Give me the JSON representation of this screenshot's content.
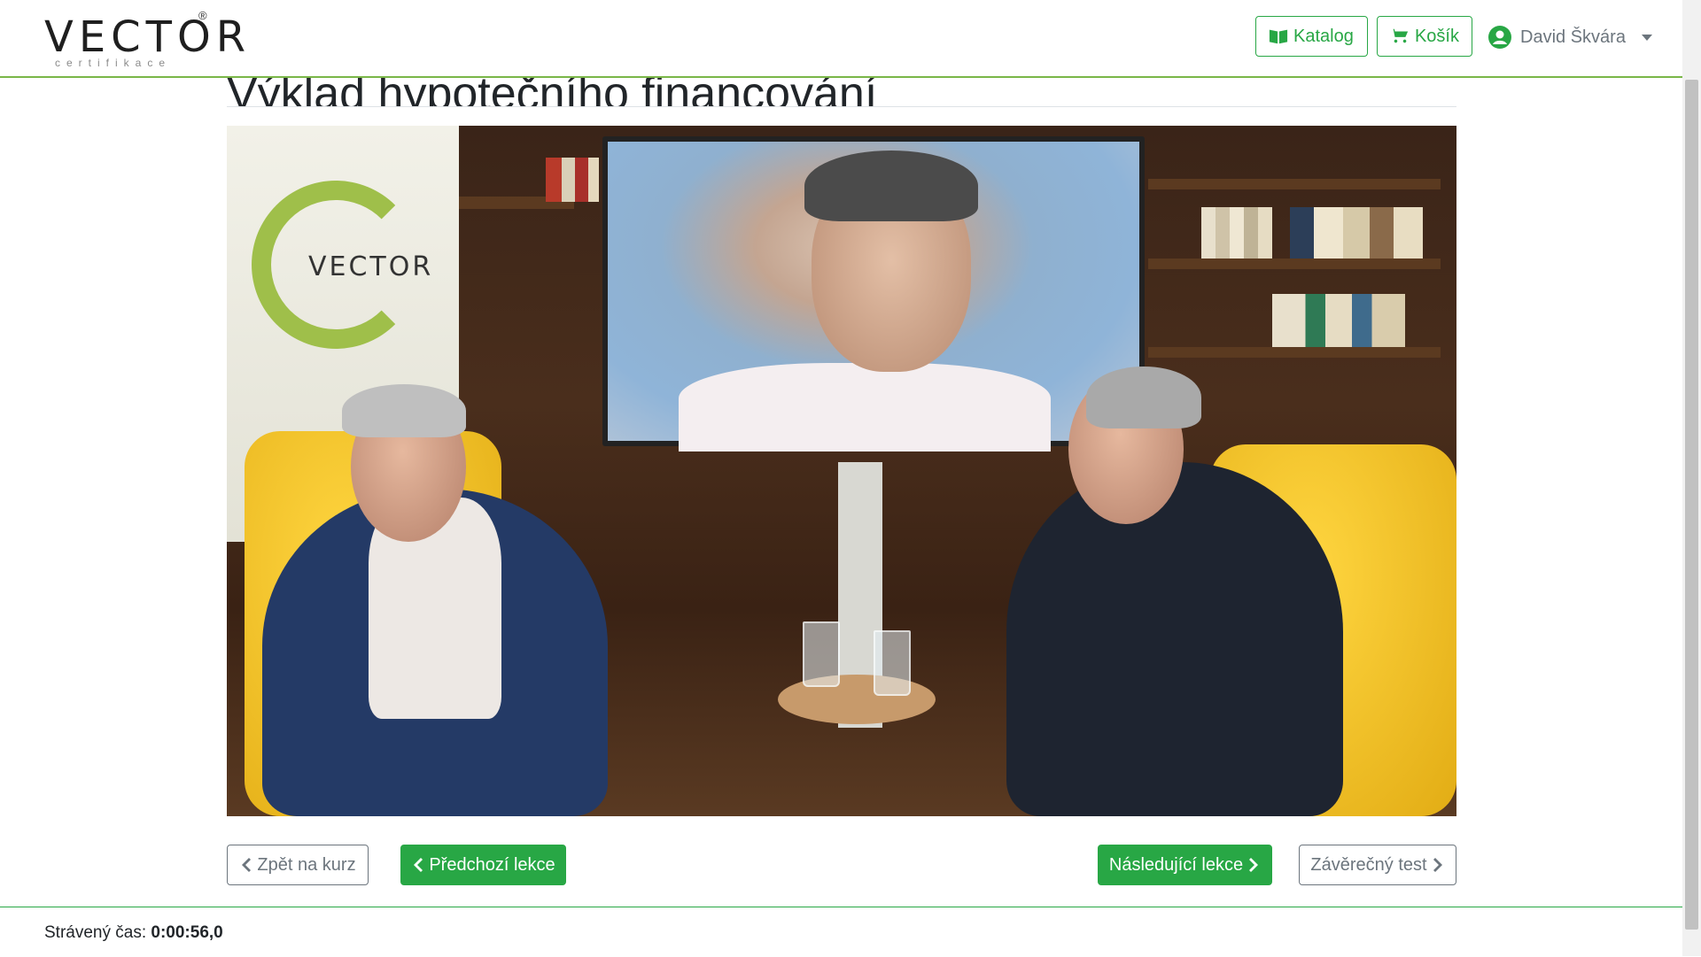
{
  "header": {
    "logo_text": "VECTOR",
    "logo_registered": "®",
    "logo_subtitle": "certifikace",
    "katalog_label": "Katalog",
    "kosik_label": "Košík",
    "user_name": "David Škvára"
  },
  "lesson": {
    "title": "Výklad hypotečního financování"
  },
  "video": {
    "banner_text": "VECTOR"
  },
  "controls": {
    "back_label": "Zpět na kurz",
    "prev_label": "Předchozí lekce",
    "next_label": "Následující lekce",
    "test_label": "Závěrečný test"
  },
  "footer": {
    "time_label": "Strávený čas:",
    "time_value": "0:00:56,0"
  },
  "colors": {
    "accent_green": "#28a745",
    "header_border": "#7ab648",
    "chair_yellow": "#f2c21c"
  },
  "icons": {
    "katalog": "book-icon",
    "kosik": "cart-icon",
    "user": "user-circle-icon",
    "back": "chevron-left-icon",
    "prev": "chevron-left-icon",
    "next": "chevron-right-icon",
    "test": "chevron-right-icon"
  }
}
